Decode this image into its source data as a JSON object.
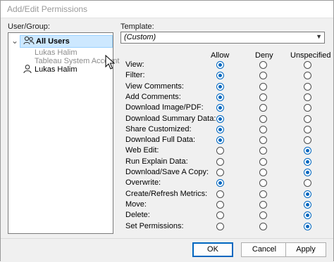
{
  "window": {
    "title": "Add/Edit Permissions"
  },
  "user_group": {
    "label": "User/Group:",
    "tree": {
      "root": {
        "label": "All Users",
        "expand_glyph": "⌄",
        "icon": "group-icon"
      },
      "children": [
        {
          "label": "Lukas Halim",
          "dimmed": true
        },
        {
          "label": "Tableau System Account",
          "dimmed": true
        }
      ],
      "users": [
        {
          "label": "Lukas Halim",
          "icon": "user-icon"
        }
      ]
    }
  },
  "template": {
    "label": "Template:",
    "value": "(Custom)"
  },
  "columns": {
    "allow": "Allow",
    "deny": "Deny",
    "unspecified": "Unspecified"
  },
  "permissions": [
    {
      "label": "View:",
      "selected": "allow"
    },
    {
      "label": "Filter:",
      "selected": "allow"
    },
    {
      "label": "View Comments:",
      "selected": "allow"
    },
    {
      "label": "Add Comments:",
      "selected": "allow"
    },
    {
      "label": "Download Image/PDF:",
      "selected": "allow"
    },
    {
      "label": "Download Summary Data:",
      "selected": "allow"
    },
    {
      "label": "Share Customized:",
      "selected": "allow"
    },
    {
      "label": "Download Full Data:",
      "selected": "allow"
    },
    {
      "label": "Web Edit:",
      "selected": "unspecified"
    },
    {
      "label": "Run Explain Data:",
      "selected": "unspecified"
    },
    {
      "label": "Download/Save A Copy:",
      "selected": "unspecified"
    },
    {
      "label": "Overwrite:",
      "selected": "allow"
    },
    {
      "label": "Create/Refresh Metrics:",
      "selected": "unspecified"
    },
    {
      "label": "Move:",
      "selected": "unspecified"
    },
    {
      "label": "Delete:",
      "selected": "unspecified"
    },
    {
      "label": "Set Permissions:",
      "selected": "unspecified"
    }
  ],
  "buttons": {
    "ok": "OK",
    "cancel": "Cancel",
    "apply": "Apply"
  },
  "colors": {
    "accent": "#0067c0",
    "selection": "#cde8ff"
  }
}
